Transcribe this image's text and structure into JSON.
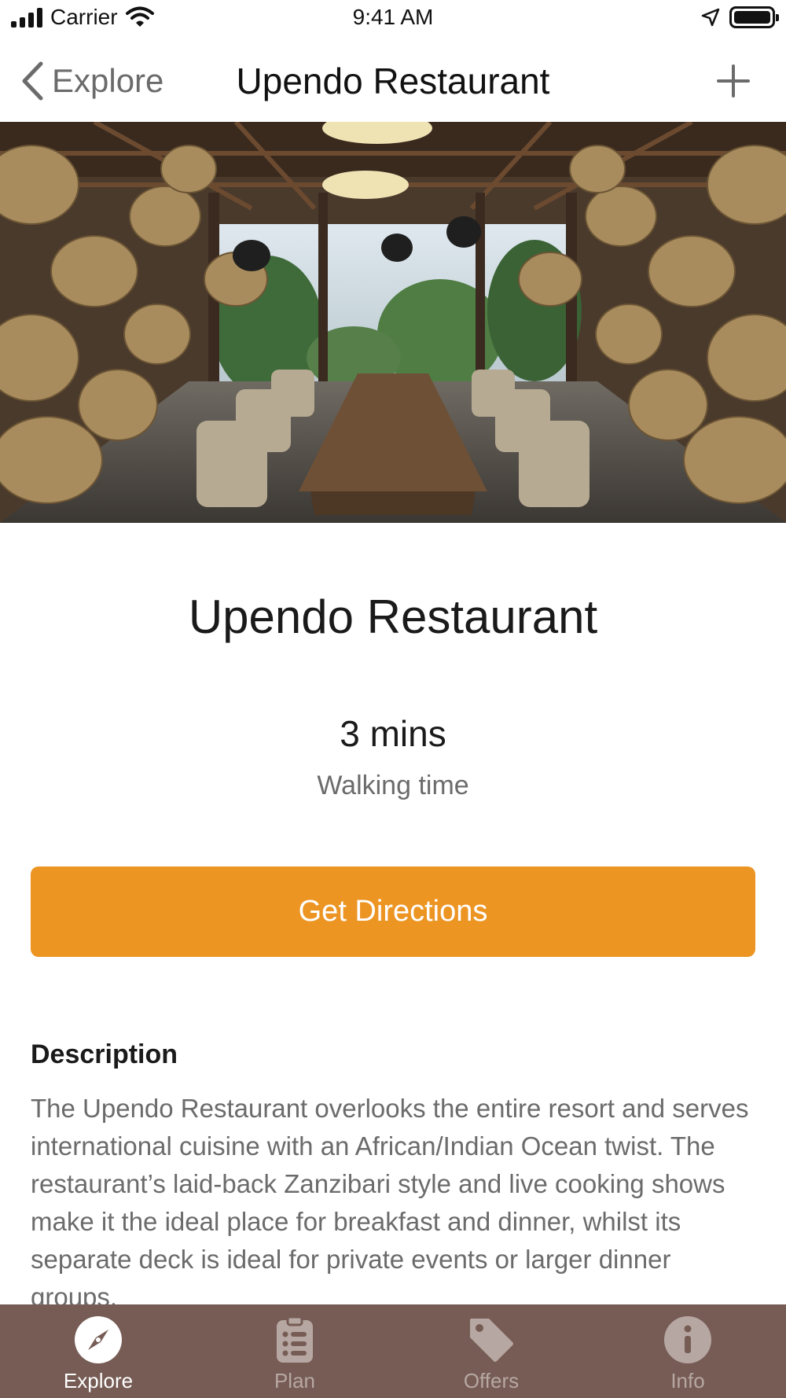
{
  "status_bar": {
    "carrier": "Carrier",
    "time": "9:41 AM"
  },
  "nav": {
    "back_label": "Explore",
    "title": "Upendo Restaurant",
    "add_icon": "plus-icon"
  },
  "place": {
    "name": "Upendo Restaurant",
    "walk_time": "3 mins",
    "walk_label": "Walking time",
    "directions_label": "Get Directions"
  },
  "description": {
    "heading": "Description",
    "body": "The Upendo Restaurant overlooks the entire resort and serves international cuisine with an African/Indian Ocean twist. The restaurant’s laid-back Zanzibari style and live cooking shows make it the ideal place for breakfast and dinner, whilst its separate deck is ideal for private events or larger dinner groups."
  },
  "tabs": [
    {
      "label": "Explore",
      "icon": "compass-icon",
      "active": true
    },
    {
      "label": "Plan",
      "icon": "list-icon",
      "active": false
    },
    {
      "label": "Offers",
      "icon": "tag-icon",
      "active": false
    },
    {
      "label": "Info",
      "icon": "info-icon",
      "active": false
    }
  ],
  "colors": {
    "accent": "#ec9523",
    "tab_bar": "#765c55",
    "tab_inactive": "#b7a7a2",
    "tab_active": "#ffffff"
  }
}
